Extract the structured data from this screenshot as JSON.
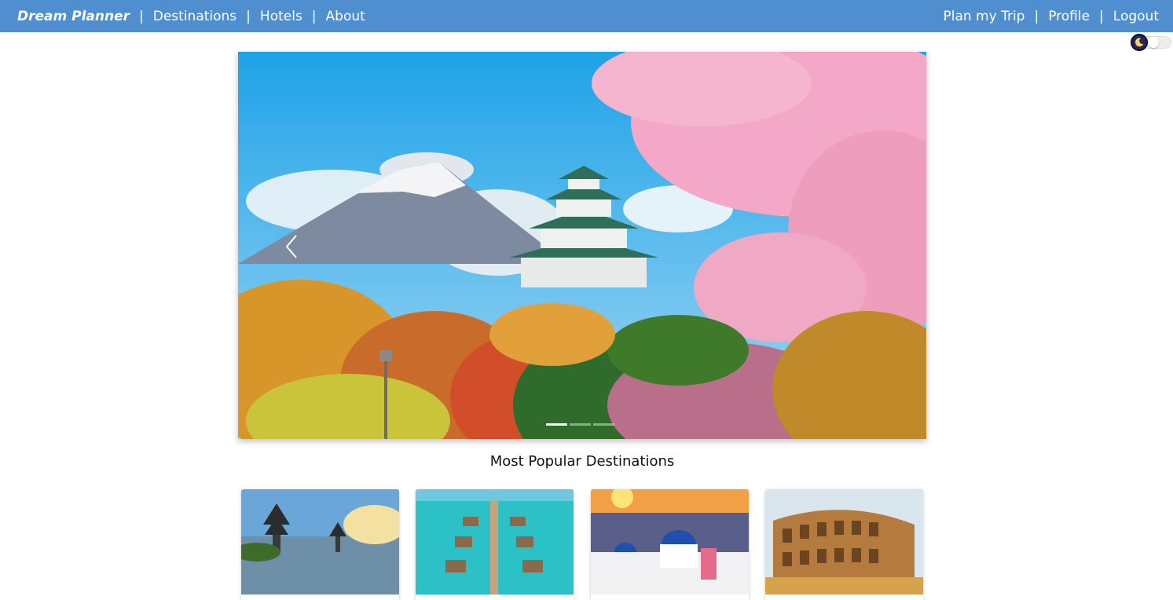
{
  "navbar": {
    "brand": "Dream Planner",
    "left_links": [
      "Destinations",
      "Hotels",
      "About"
    ],
    "right_links": [
      "Plan my Trip",
      "Profile",
      "Logout"
    ],
    "separator": "|",
    "background_color": "#4f8fd0"
  },
  "theme_toggle": {
    "icon": "moon-icon",
    "state": "off"
  },
  "carousel": {
    "slides_count": 3,
    "active_slide": 1,
    "prev_icon": "chevron-left-icon"
  },
  "popular": {
    "title": "Most Popular Destinations",
    "cards": [
      {
        "image": "bali-temple-image"
      },
      {
        "image": "overwater-bungalows-image"
      },
      {
        "image": "santorini-image"
      },
      {
        "image": "colosseum-image"
      }
    ]
  }
}
